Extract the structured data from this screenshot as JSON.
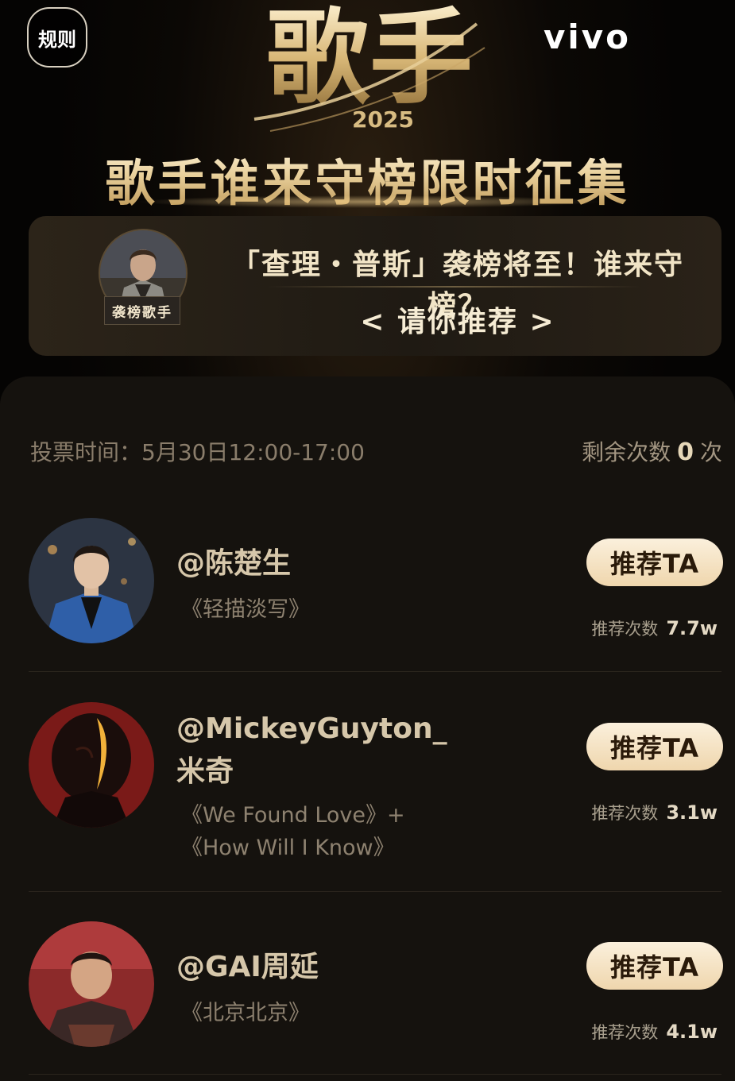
{
  "header": {
    "rules_label": "规则",
    "brand": "vivo",
    "logo_text": "歌手",
    "logo_year": "2025",
    "banner_title": "歌手谁来守榜限时征集"
  },
  "challenger": {
    "badge": "袭榜歌手",
    "headline": "「查理・普斯」袭榜将至！谁来守榜？",
    "cta": "< 请你推荐 >"
  },
  "vote": {
    "time_label": "投票时间：5月30日12:00-17:00",
    "remaining_label": "剩余次数",
    "remaining_count": "0",
    "remaining_unit": "次"
  },
  "singers": [
    {
      "name": "@陈楚生",
      "songs": [
        "《轻描淡写》"
      ],
      "button": "推荐TA",
      "count_label": "推荐次数",
      "count": "7.7w"
    },
    {
      "name": "@MickeyGuyton_米奇",
      "songs": [
        "《We Found Love》+",
        "《How Will I Know》"
      ],
      "button": "推荐TA",
      "count_label": "推荐次数",
      "count": "3.1w"
    },
    {
      "name": "@GAI周延",
      "songs": [
        "《北京北京》"
      ],
      "button": "推荐TA",
      "count_label": "推荐次数",
      "count": "4.1w"
    }
  ],
  "colors": {
    "background": "#050403",
    "panel": "#15120e",
    "gold_text": "#d6c7aa",
    "button_gradient_start": "#fbf0dc",
    "button_gradient_end": "#efd6ad"
  }
}
